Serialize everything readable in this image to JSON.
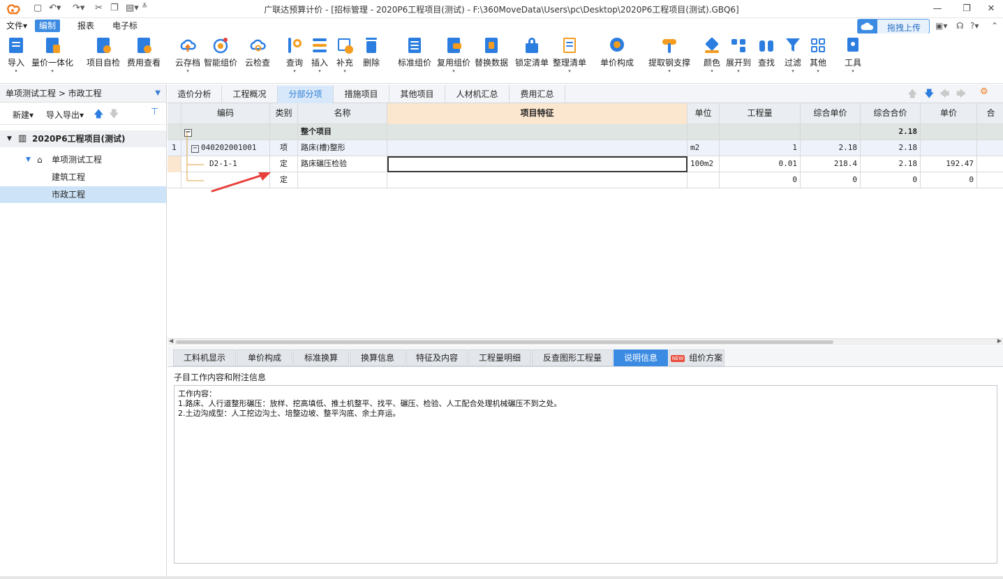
{
  "title": "广联达预算计价 - [招标管理 - 2020P6工程项目(测试) - F:\\360MoveData\\Users\\pc\\Desktop\\2020P6工程项目(测试).GBQ6]",
  "menu": [
    "文件",
    "编制",
    "报表",
    "电子标"
  ],
  "upload_label": "拖拽上传",
  "toolbar": [
    {
      "label": "导入"
    },
    {
      "label": "量价一体化"
    },
    {
      "label": "项目自检"
    },
    {
      "label": "费用查看"
    },
    {
      "label": "云存档"
    },
    {
      "label": "智能组价"
    },
    {
      "label": "云检查"
    },
    {
      "label": "查询"
    },
    {
      "label": "插入"
    },
    {
      "label": "补充"
    },
    {
      "label": "删除"
    },
    {
      "label": "标准组价"
    },
    {
      "label": "复用组价"
    },
    {
      "label": "替换数据"
    },
    {
      "label": "锁定清单"
    },
    {
      "label": "整理清单"
    },
    {
      "label": "单价构成"
    },
    {
      "label": "提取钢支撑"
    },
    {
      "label": "颜色"
    },
    {
      "label": "展开到"
    },
    {
      "label": "查找"
    },
    {
      "label": "过滤"
    },
    {
      "label": "其他"
    },
    {
      "label": "工具"
    }
  ],
  "left": {
    "breadcrumb": "单项测试工程 > 市政工程",
    "new_label": "新建",
    "import_label": "导入导出",
    "tree": {
      "root": "2020P6工程项目(测试)",
      "project": "单项测试工程",
      "children": [
        "建筑工程",
        "市政工程"
      ]
    }
  },
  "tabs": [
    "造价分析",
    "工程概况",
    "分部分项",
    "措施项目",
    "其他项目",
    "人材机汇总",
    "费用汇总"
  ],
  "grid": {
    "headers": [
      "编码",
      "类别",
      "名称",
      "项目特征",
      "单位",
      "工程量",
      "综合单价",
      "综合合价",
      "单价",
      "合"
    ],
    "whole_row": {
      "name": "整个项目",
      "total": "2.18"
    },
    "rows": [
      {
        "no": "1",
        "code": "040202001001",
        "type": "项",
        "name": "路床(槽)整形",
        "unit": "m2",
        "qty": "1",
        "price": "2.18",
        "total": "2.18",
        "unit_price": ""
      },
      {
        "no": "",
        "code": "D2-1-1",
        "type": "定",
        "name": "路床碾压检验",
        "unit": "100m2",
        "qty": "0.01",
        "price": "218.4",
        "total": "2.18",
        "unit_price": "192.47"
      },
      {
        "no": "",
        "code": "",
        "type": "定",
        "name": "",
        "unit": "",
        "qty": "0",
        "price": "0",
        "total": "0",
        "unit_price": "0"
      }
    ]
  },
  "bottom_tabs": [
    "工料机显示",
    "单价构成",
    "标准换算",
    "换算信息",
    "特征及内容",
    "工程量明细",
    "反查图形工程量",
    "说明信息",
    "组价方案"
  ],
  "notes": {
    "title": "子目工作内容和附注信息",
    "lines": [
      "工作内容：",
      "1.路床、人行道整形碾压：放样、挖高填低、推土机整平、找平、碾压、检验、人工配合处理机械碾压不到之处。",
      "2.土边沟成型：人工挖边沟土、培整边坡、整平沟底、余土弃运。"
    ]
  },
  "colors": {
    "accent": "#3b8be3",
    "feature_header": "#fbe6cf",
    "arrow": "#e8413c"
  }
}
